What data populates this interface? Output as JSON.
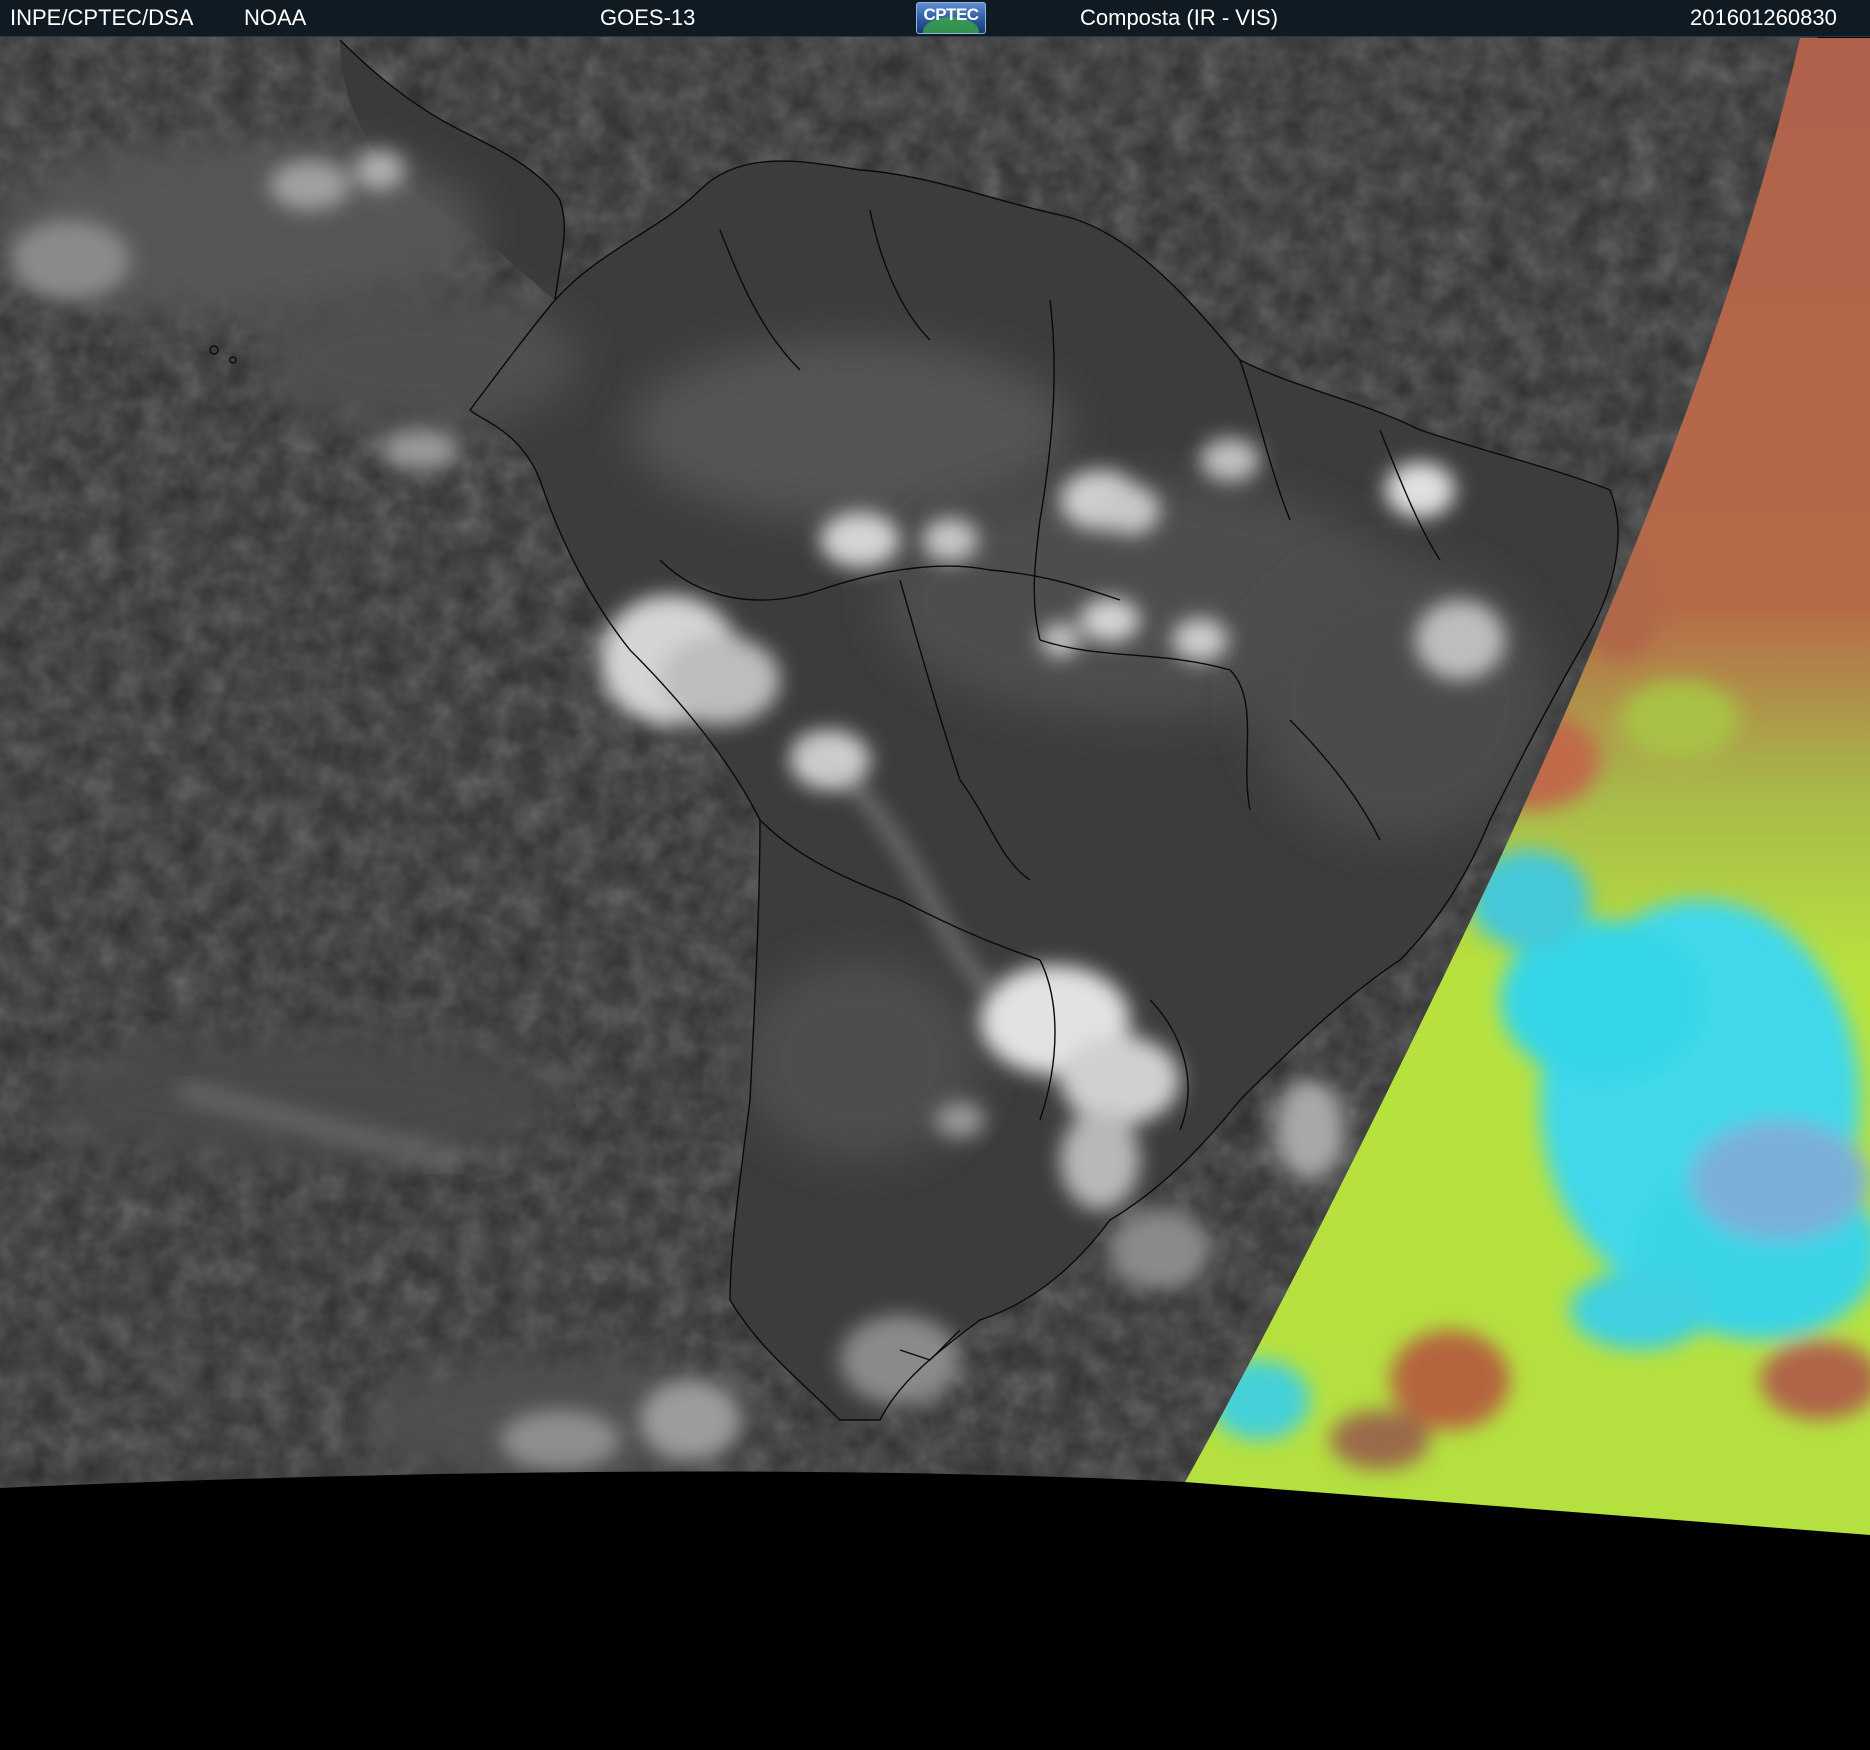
{
  "header": {
    "institution": "INPE/CPTEC/DSA",
    "agency": "NOAA",
    "satellite": "GOES-13",
    "logo_text": "CPTEC",
    "product": "Composta (IR - VIS)",
    "timestamp": "201601260830"
  },
  "colors": {
    "header_background": "#0f1a22",
    "header_text": "#ffffff",
    "ir_background": "#2e2e2e",
    "land_surface": "#3f3f3f",
    "cloud_white": "#d8d8d8",
    "coastline_border": "#0a0a0a",
    "space_black": "#000000",
    "vis_red": "#b8624a",
    "vis_yellow_green": "#b7e23e",
    "vis_cyan": "#35d6e8"
  }
}
